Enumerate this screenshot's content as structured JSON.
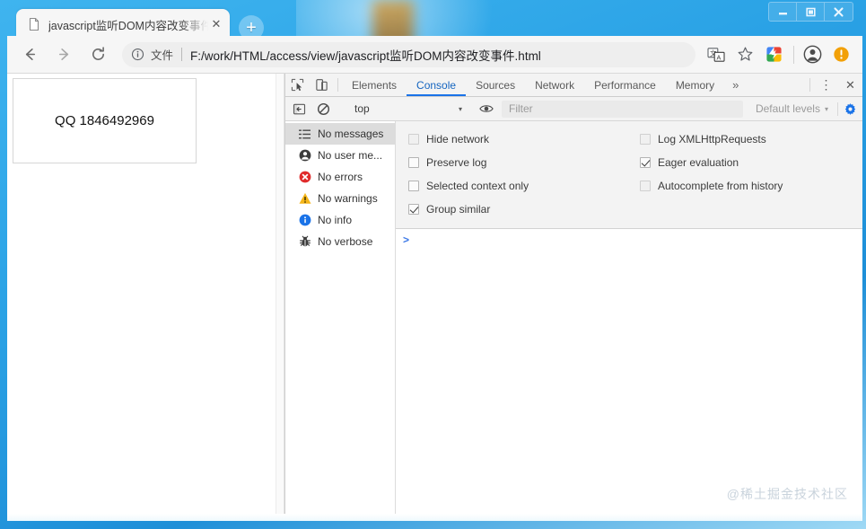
{
  "window": {
    "controls": [
      {
        "name": "minimize",
        "glyph": "–"
      },
      {
        "name": "maximize",
        "glyph": "❐"
      },
      {
        "name": "close",
        "glyph": "✕"
      }
    ]
  },
  "browser": {
    "tab": {
      "title": "javascript监听DOM内容改变事件.html",
      "close_label": "✕"
    },
    "new_tab_label": "+",
    "nav": {
      "back_label": "←",
      "forward_label": "→",
      "reload_label": "⟳"
    },
    "omnibox": {
      "security_label": "文件",
      "url": "F:/work/HTML/access/view/javascript监听DOM内容改变事件.html"
    },
    "toolbar_icons": [
      "translate-icon",
      "bookmark-star-icon",
      "extension-icon",
      "profile-avatar-icon",
      "update-alert-icon"
    ]
  },
  "page": {
    "box_text": "QQ 1846492969"
  },
  "devtools": {
    "tabs": [
      {
        "label": "Elements",
        "active": false
      },
      {
        "label": "Console",
        "active": true
      },
      {
        "label": "Sources",
        "active": false
      },
      {
        "label": "Network",
        "active": false
      },
      {
        "label": "Performance",
        "active": false
      },
      {
        "label": "Memory",
        "active": false
      }
    ],
    "more_label": "»",
    "menu_label": "⋮",
    "close_label": "✕",
    "filterbar": {
      "context": "top",
      "context_caret": "▾",
      "filter_placeholder": "Filter",
      "levels_label": "Default levels",
      "levels_caret": "▾"
    },
    "sidebar": [
      {
        "label": "No messages",
        "icon": "list-icon",
        "selected": true
      },
      {
        "label": "No user me...",
        "icon": "user-icon",
        "selected": false
      },
      {
        "label": "No errors",
        "icon": "error-icon",
        "selected": false
      },
      {
        "label": "No warnings",
        "icon": "warning-icon",
        "selected": false
      },
      {
        "label": "No info",
        "icon": "info-icon",
        "selected": false
      },
      {
        "label": "No verbose",
        "icon": "bug-icon",
        "selected": false
      }
    ],
    "settings": [
      {
        "label": "Hide network",
        "checked": false,
        "dim": true
      },
      {
        "label": "Preserve log",
        "checked": false,
        "dim": false
      },
      {
        "label": "Selected context only",
        "checked": false,
        "dim": false
      },
      {
        "label": "Group similar",
        "checked": true,
        "dim": false
      },
      {
        "label": "Log XMLHttpRequests",
        "checked": false,
        "dim": true
      },
      {
        "label": "Eager evaluation",
        "checked": true,
        "dim": false
      },
      {
        "label": "Autocomplete from history",
        "checked": false,
        "dim": true
      },
      {
        "label": "",
        "checked": false,
        "dim": false
      }
    ],
    "console_prompt": ">"
  },
  "watermark": "@稀土掘金技术社区",
  "colors": {
    "accent": "#1a73e8",
    "error": "#d93025",
    "warning": "#f5a623",
    "info": "#1a73e8",
    "desktop": "#2ba3e6"
  }
}
